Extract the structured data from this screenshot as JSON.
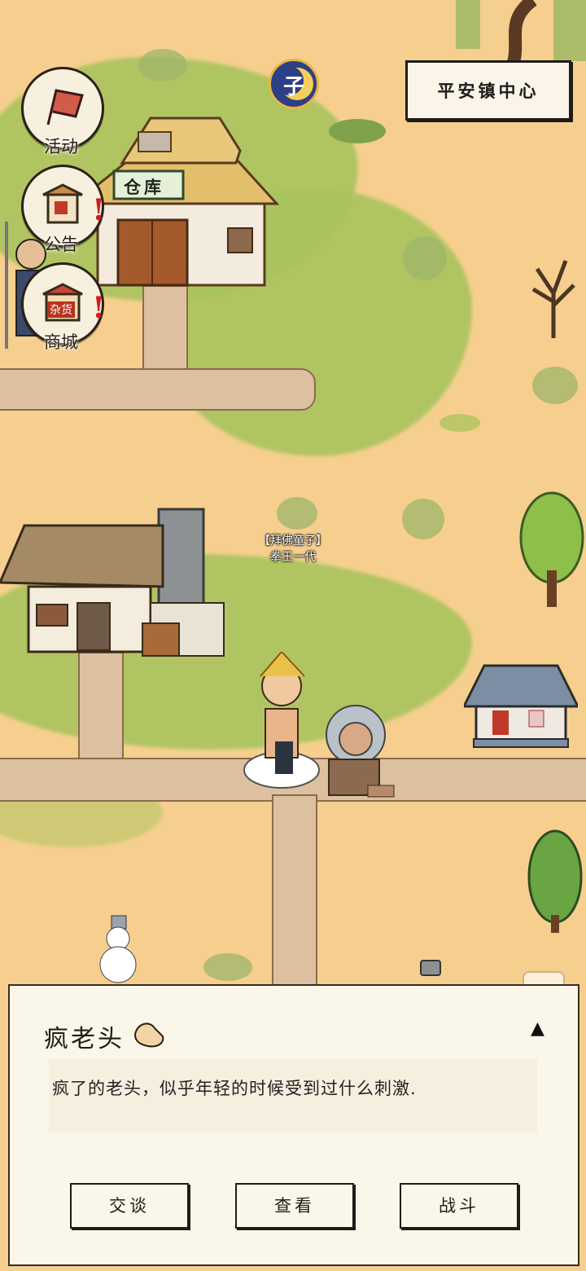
{
  "location": {
    "name": "平安镇中心"
  },
  "time_badge": {
    "glyph": "子"
  },
  "side_menu": [
    {
      "id": "activity",
      "label": "活动",
      "badge": ""
    },
    {
      "id": "notice",
      "label": "公告",
      "badge": "!"
    },
    {
      "id": "shop",
      "label": "商城",
      "badge": "!"
    }
  ],
  "buildings": {
    "warehouse_sign": "仓库",
    "shop_sign": "杂货"
  },
  "map_npc": {
    "title_line1": "【拜佛童子】",
    "title_line2": "拳王一代"
  },
  "dialog": {
    "npc_name": "疯老头",
    "description": "疯了的老头，似乎年轻的时候受到过什么刺激.",
    "actions": [
      "交谈",
      "查看",
      "战斗"
    ],
    "collapse_glyph": "▲"
  },
  "colors": {
    "sand": "#f6cf8f",
    "grass": "#a9c45d",
    "road": "#dcc0a0",
    "panel": "#fbf6ea",
    "alert": "#d11b1b"
  }
}
